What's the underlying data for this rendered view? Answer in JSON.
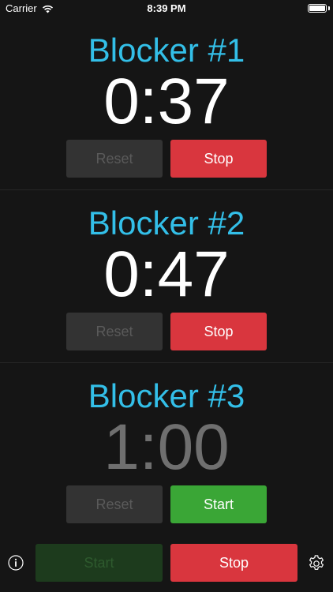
{
  "status_bar": {
    "carrier": "Carrier",
    "time": "8:39 PM",
    "battery_level": 1.0
  },
  "timers": [
    {
      "title": "Blocker #1",
      "time": "0:37",
      "reset_label": "Reset",
      "action_label": "Stop",
      "state": "running"
    },
    {
      "title": "Blocker #2",
      "time": "0:47",
      "reset_label": "Reset",
      "action_label": "Stop",
      "state": "running"
    },
    {
      "title": "Blocker #3",
      "time": "1:00",
      "reset_label": "Reset",
      "action_label": "Start",
      "state": "idle"
    }
  ],
  "bottom_bar": {
    "start_all_label": "Start",
    "stop_all_label": "Stop",
    "info_icon": "info-icon",
    "settings_icon": "gear-icon"
  },
  "colors": {
    "background": "#151515",
    "title_blue": "#33bfe8",
    "stop_red": "#d9363e",
    "start_green": "#3aa636",
    "disabled_gray": "#333333"
  }
}
